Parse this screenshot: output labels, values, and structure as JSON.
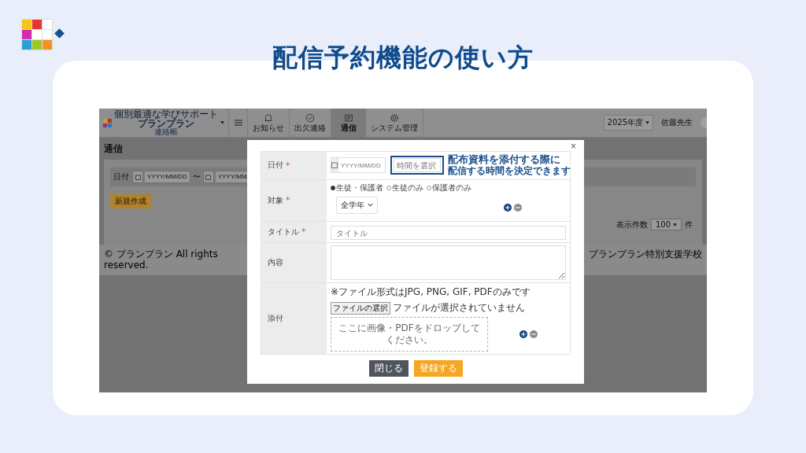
{
  "slide": {
    "title": "配信予約機能の使い方"
  },
  "app": {
    "header": {
      "brand": "プランプラン",
      "brand_tagline": "個別最適な学びサポート",
      "brand_sub": "連絡帳",
      "nav": [
        {
          "label": "お知らせ",
          "selected": false
        },
        {
          "label": "出欠連絡",
          "selected": false
        },
        {
          "label": "通信",
          "selected": true
        },
        {
          "label": "システム管理",
          "selected": false
        }
      ],
      "year": "2025年度",
      "user": "佐藤先生"
    },
    "page_title": "通信",
    "filter": {
      "label": "日付",
      "from_placeholder": "YYYY/MM/DD",
      "separator": "〜",
      "to_placeholder": "YYYY/MM/"
    },
    "new_button": "新規作成",
    "per_page": {
      "label": "表示件数",
      "value": "100",
      "unit": "件"
    },
    "footer": {
      "copyright": "© プランプラン All rights reserved.",
      "school": "プランプラン特別支援学校"
    }
  },
  "modal": {
    "close": "×",
    "rows": [
      {
        "kind": "datetime",
        "label": "日付",
        "required_mark": "*",
        "date_placeholder": "YYYY/MM/DD",
        "time_placeholder": "時間を選択"
      },
      {
        "kind": "target",
        "label": "対象",
        "required_mark": "*",
        "options": [
          {
            "label": "生徒・保護者",
            "selected": true
          },
          {
            "label": "生徒のみ",
            "selected": false
          },
          {
            "label": "保護者のみ",
            "selected": false
          }
        ],
        "grade": "全学年"
      },
      {
        "kind": "text",
        "label": "タイトル",
        "required_mark": "*",
        "placeholder": "タイトル"
      },
      {
        "kind": "textarea",
        "label": "内容"
      },
      {
        "kind": "file",
        "label": "添付",
        "note": "※ファイル形式はJPG, PNG, GIF, PDFのみです",
        "choose": "ファイルの選択",
        "no_file": "ファイルが選択されていません",
        "drop": "ここに画像・PDFをドロップしてください。"
      }
    ],
    "buttons": [
      {
        "kind": "close",
        "label": "閉じる"
      },
      {
        "kind": "submit",
        "label": "登録する"
      }
    ]
  },
  "callout": {
    "lines": [
      "配布資料を添付する際に",
      "配信する時間を決定できます"
    ]
  }
}
